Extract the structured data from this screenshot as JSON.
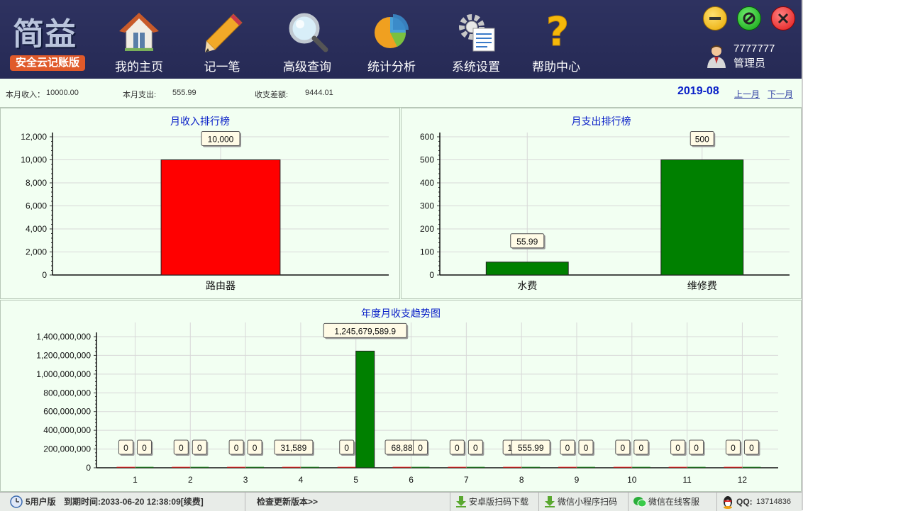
{
  "app": {
    "logo_title": "简益",
    "logo_badge": "安全云记账版"
  },
  "nav": [
    {
      "label": "我的主页",
      "icon": "home-icon"
    },
    {
      "label": "记一笔",
      "icon": "pencil-icon"
    },
    {
      "label": "高级查询",
      "icon": "magnifier-icon"
    },
    {
      "label": "统计分析",
      "icon": "pie-chart-icon"
    },
    {
      "label": "系统设置",
      "icon": "gear-icon"
    },
    {
      "label": "帮助中心",
      "icon": "question-icon"
    }
  ],
  "window_controls": {
    "minimize": "minimize-icon",
    "maximize": "maximize-icon",
    "close": "close-icon"
  },
  "user": {
    "name": "7777777",
    "role": "管理员"
  },
  "summary": {
    "income_label": "本月收入：",
    "income_value": "10000.00",
    "expense_label": "本月支出:",
    "expense_value": "555.99",
    "diff_label": "收支差额:",
    "diff_value": "9444.01",
    "period": "2019-08",
    "prev_label": "上一月",
    "next_label": "下一月"
  },
  "colors": {
    "income": "#ff0000",
    "expense": "#008000",
    "title": "#0a20c8",
    "header": "#2e3260"
  },
  "chart_data": [
    {
      "type": "bar",
      "title": "月收入排行榜",
      "categories": [
        "路由器"
      ],
      "values": [
        10000
      ],
      "value_labels": [
        "10,000"
      ],
      "yticks": [
        "0",
        "2,000",
        "4,000",
        "6,000",
        "8,000",
        "10,000",
        "12,000"
      ],
      "ylim": [
        0,
        12000
      ],
      "color": "#ff0000"
    },
    {
      "type": "bar",
      "title": "月支出排行榜",
      "categories": [
        "水费",
        "维修费"
      ],
      "values": [
        55.99,
        500
      ],
      "value_labels": [
        "55.99",
        "500"
      ],
      "yticks": [
        "0",
        "100",
        "200",
        "300",
        "400",
        "500",
        "600"
      ],
      "ylim": [
        0,
        600
      ],
      "color": "#008000"
    },
    {
      "type": "bar",
      "title": "年度月收支趋势图",
      "categories": [
        "1",
        "2",
        "3",
        "4",
        "5",
        "6",
        "7",
        "8",
        "9",
        "10",
        "11",
        "12"
      ],
      "yticks": [
        "0",
        "200,000,000",
        "400,000,000",
        "600,000,000",
        "800,000,000",
        "1,000,000,000",
        "1,200,000,000",
        "1,400,000,000"
      ],
      "ylim": [
        0,
        1400000000
      ],
      "series": [
        {
          "color": "#ff0000",
          "values": [
            0,
            0,
            0,
            31589,
            0,
            68880,
            0,
            10000,
            0,
            0,
            0,
            0
          ],
          "labels": [
            "0",
            "0",
            "0",
            "31,589",
            "0",
            "68,88",
            "0",
            "10",
            "0",
            "0",
            "0",
            "0"
          ]
        },
        {
          "color": "#008000",
          "values": [
            0,
            0,
            0,
            0,
            1245679589.9,
            0,
            0,
            555.99,
            0,
            0,
            0,
            0
          ],
          "labels": [
            "0",
            "0",
            "0",
            "",
            "1,245,679,589.9",
            "0",
            "0",
            "555.99",
            "0",
            "0",
            "0",
            "0"
          ]
        }
      ]
    }
  ],
  "footer": {
    "edition": "5用户版",
    "expiry": "到期时间:2033-06-20 12:38:09[续费]",
    "update": "检查更新版本>>",
    "android": "安卓版扫码下载",
    "miniapp": "微信小程序扫码",
    "wechat": "微信在线客服",
    "qq_label": "QQ:",
    "qq_value": "13714836"
  }
}
